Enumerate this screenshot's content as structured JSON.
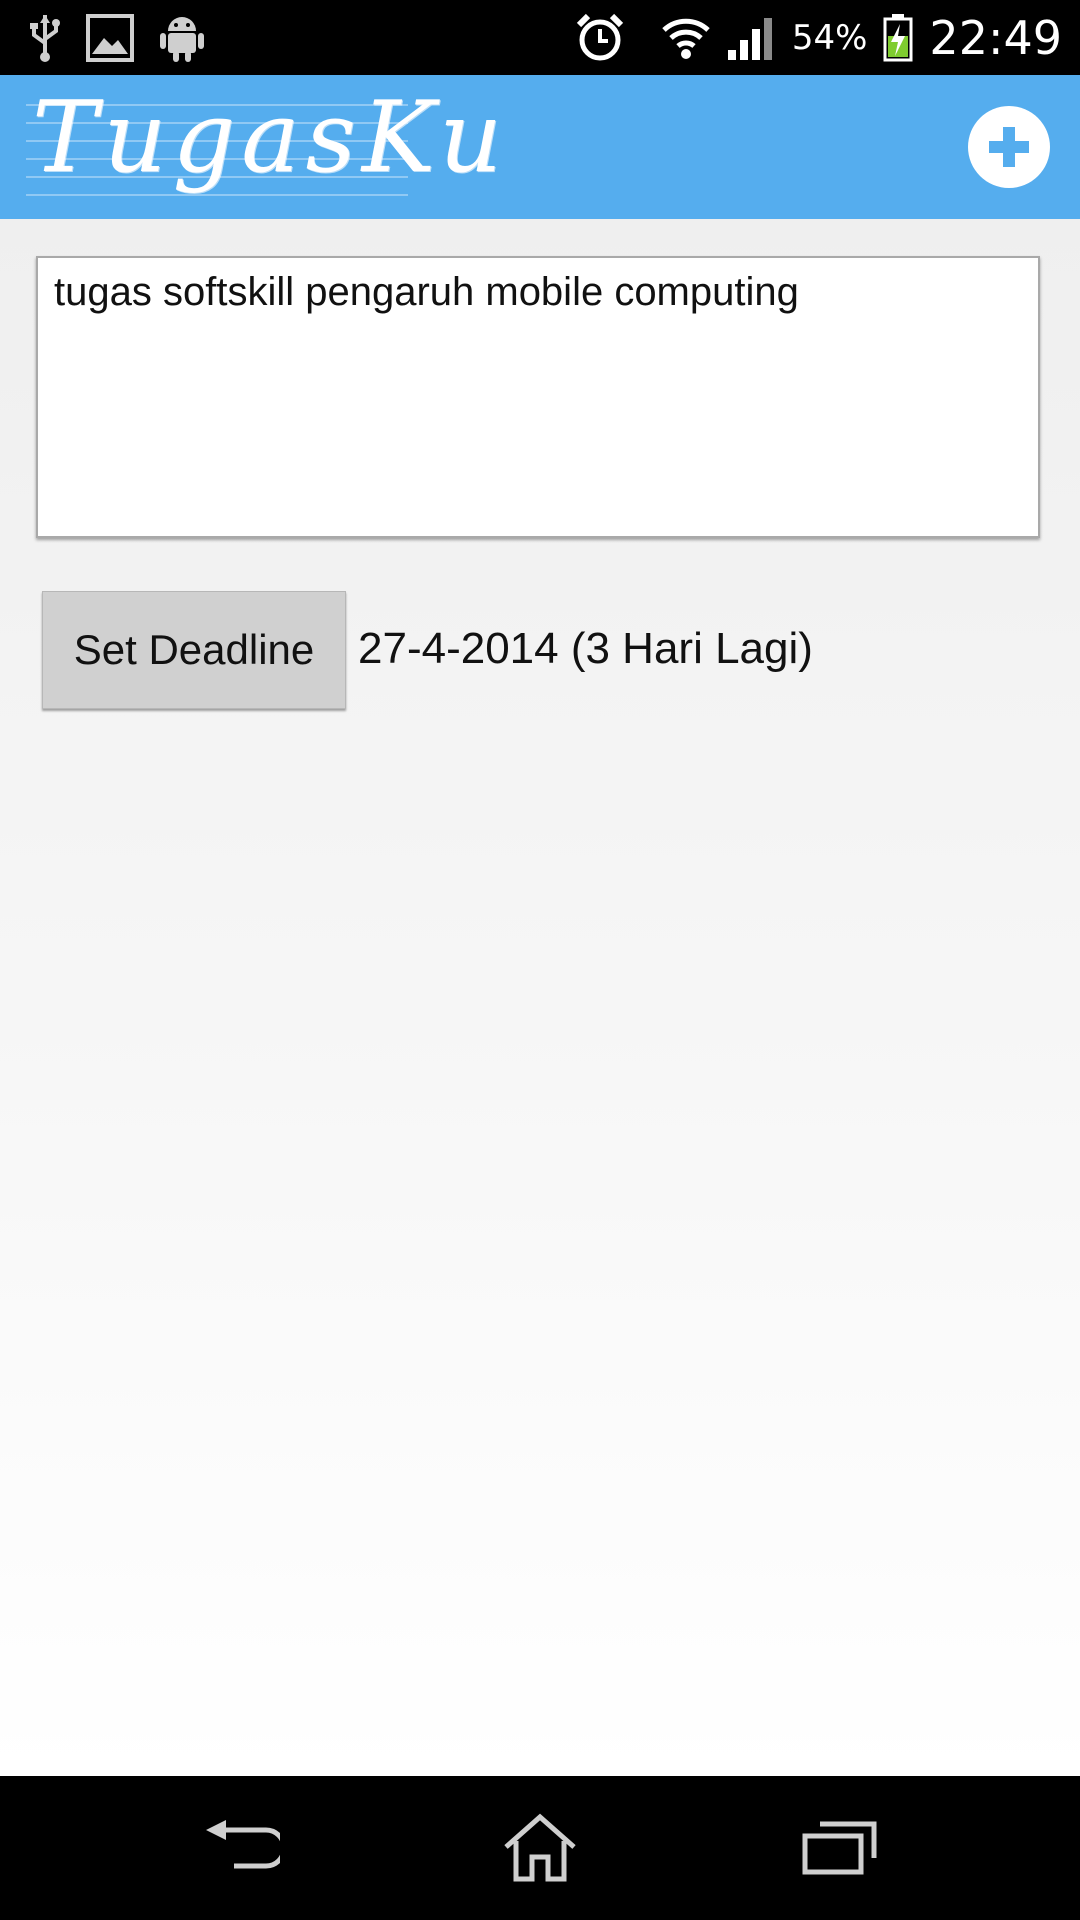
{
  "status_bar": {
    "left_icons": [
      "usb-icon",
      "image-icon",
      "android-icon"
    ],
    "right_icons": [
      "alarm-icon",
      "wifi-icon",
      "signal-icon",
      "battery-charging-icon"
    ],
    "battery_percent": "54%",
    "time": "22:49"
  },
  "action_bar": {
    "app_title": "TugasKu",
    "add_button_icon": "plus-icon",
    "color": "#55adee"
  },
  "form": {
    "task_text": "tugas softskill pengaruh mobile computing",
    "deadline_button_label": "Set Deadline",
    "deadline_value": "27-4-2014 (3 Hari Lagi)"
  },
  "nav_bar": {
    "buttons": [
      "back-icon",
      "home-icon",
      "recent-apps-icon"
    ]
  }
}
